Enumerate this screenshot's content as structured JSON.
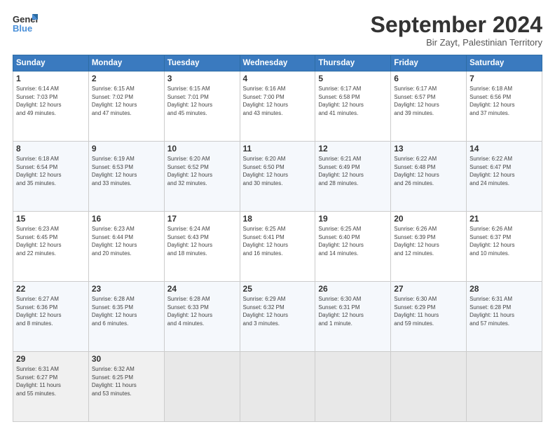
{
  "header": {
    "title": "September 2024",
    "subtitle": "Bir Zayt, Palestinian Territory"
  },
  "days_of_week": [
    "Sunday",
    "Monday",
    "Tuesday",
    "Wednesday",
    "Thursday",
    "Friday",
    "Saturday"
  ],
  "weeks": [
    [
      {
        "day": 1,
        "info": "Sunrise: 6:14 AM\nSunset: 7:03 PM\nDaylight: 12 hours\nand 49 minutes."
      },
      {
        "day": 2,
        "info": "Sunrise: 6:15 AM\nSunset: 7:02 PM\nDaylight: 12 hours\nand 47 minutes."
      },
      {
        "day": 3,
        "info": "Sunrise: 6:15 AM\nSunset: 7:01 PM\nDaylight: 12 hours\nand 45 minutes."
      },
      {
        "day": 4,
        "info": "Sunrise: 6:16 AM\nSunset: 7:00 PM\nDaylight: 12 hours\nand 43 minutes."
      },
      {
        "day": 5,
        "info": "Sunrise: 6:17 AM\nSunset: 6:58 PM\nDaylight: 12 hours\nand 41 minutes."
      },
      {
        "day": 6,
        "info": "Sunrise: 6:17 AM\nSunset: 6:57 PM\nDaylight: 12 hours\nand 39 minutes."
      },
      {
        "day": 7,
        "info": "Sunrise: 6:18 AM\nSunset: 6:56 PM\nDaylight: 12 hours\nand 37 minutes."
      }
    ],
    [
      {
        "day": 8,
        "info": "Sunrise: 6:18 AM\nSunset: 6:54 PM\nDaylight: 12 hours\nand 35 minutes."
      },
      {
        "day": 9,
        "info": "Sunrise: 6:19 AM\nSunset: 6:53 PM\nDaylight: 12 hours\nand 33 minutes."
      },
      {
        "day": 10,
        "info": "Sunrise: 6:20 AM\nSunset: 6:52 PM\nDaylight: 12 hours\nand 32 minutes."
      },
      {
        "day": 11,
        "info": "Sunrise: 6:20 AM\nSunset: 6:50 PM\nDaylight: 12 hours\nand 30 minutes."
      },
      {
        "day": 12,
        "info": "Sunrise: 6:21 AM\nSunset: 6:49 PM\nDaylight: 12 hours\nand 28 minutes."
      },
      {
        "day": 13,
        "info": "Sunrise: 6:22 AM\nSunset: 6:48 PM\nDaylight: 12 hours\nand 26 minutes."
      },
      {
        "day": 14,
        "info": "Sunrise: 6:22 AM\nSunset: 6:47 PM\nDaylight: 12 hours\nand 24 minutes."
      }
    ],
    [
      {
        "day": 15,
        "info": "Sunrise: 6:23 AM\nSunset: 6:45 PM\nDaylight: 12 hours\nand 22 minutes."
      },
      {
        "day": 16,
        "info": "Sunrise: 6:23 AM\nSunset: 6:44 PM\nDaylight: 12 hours\nand 20 minutes."
      },
      {
        "day": 17,
        "info": "Sunrise: 6:24 AM\nSunset: 6:43 PM\nDaylight: 12 hours\nand 18 minutes."
      },
      {
        "day": 18,
        "info": "Sunrise: 6:25 AM\nSunset: 6:41 PM\nDaylight: 12 hours\nand 16 minutes."
      },
      {
        "day": 19,
        "info": "Sunrise: 6:25 AM\nSunset: 6:40 PM\nDaylight: 12 hours\nand 14 minutes."
      },
      {
        "day": 20,
        "info": "Sunrise: 6:26 AM\nSunset: 6:39 PM\nDaylight: 12 hours\nand 12 minutes."
      },
      {
        "day": 21,
        "info": "Sunrise: 6:26 AM\nSunset: 6:37 PM\nDaylight: 12 hours\nand 10 minutes."
      }
    ],
    [
      {
        "day": 22,
        "info": "Sunrise: 6:27 AM\nSunset: 6:36 PM\nDaylight: 12 hours\nand 8 minutes."
      },
      {
        "day": 23,
        "info": "Sunrise: 6:28 AM\nSunset: 6:35 PM\nDaylight: 12 hours\nand 6 minutes."
      },
      {
        "day": 24,
        "info": "Sunrise: 6:28 AM\nSunset: 6:33 PM\nDaylight: 12 hours\nand 4 minutes."
      },
      {
        "day": 25,
        "info": "Sunrise: 6:29 AM\nSunset: 6:32 PM\nDaylight: 12 hours\nand 3 minutes."
      },
      {
        "day": 26,
        "info": "Sunrise: 6:30 AM\nSunset: 6:31 PM\nDaylight: 12 hours\nand 1 minute."
      },
      {
        "day": 27,
        "info": "Sunrise: 6:30 AM\nSunset: 6:29 PM\nDaylight: 11 hours\nand 59 minutes."
      },
      {
        "day": 28,
        "info": "Sunrise: 6:31 AM\nSunset: 6:28 PM\nDaylight: 11 hours\nand 57 minutes."
      }
    ],
    [
      {
        "day": 29,
        "info": "Sunrise: 6:31 AM\nSunset: 6:27 PM\nDaylight: 11 hours\nand 55 minutes."
      },
      {
        "day": 30,
        "info": "Sunrise: 6:32 AM\nSunset: 6:25 PM\nDaylight: 11 hours\nand 53 minutes."
      },
      null,
      null,
      null,
      null,
      null
    ]
  ]
}
